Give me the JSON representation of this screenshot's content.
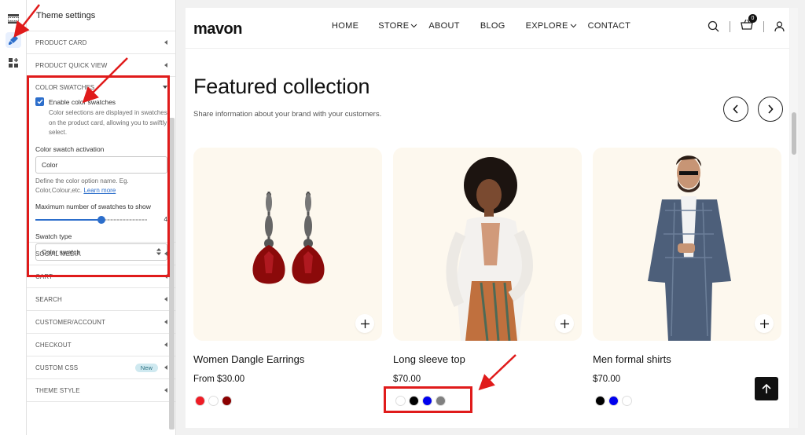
{
  "panel": {
    "title": "Theme settings",
    "sections_top": [
      "PRODUCT CARD",
      "PRODUCT QUICK VIEW"
    ],
    "color_swatches": {
      "title": "COLOR SWATCHES",
      "enable_label": "Enable color swatches",
      "enable_help": "Color selections are displayed in swatches on the product card, allowing you to swiftly select.",
      "activation_label": "Color swatch activation",
      "activation_value": "Color",
      "activation_help": "Define the color option name. Eg. Color,Colour,etc.",
      "learn_more": "Learn more",
      "max_label": "Maximum number of swatches to show",
      "max_value": "4",
      "max_fraction": 0.59,
      "type_label": "Swatch type",
      "type_value": "Color swatch"
    },
    "sections_bottom": [
      "SOCIAL MEDIA",
      "CART",
      "SEARCH",
      "CUSTOMER/ACCOUNT",
      "CHECKOUT"
    ],
    "custom_css": {
      "label": "CUSTOM CSS",
      "badge": "New"
    },
    "theme_style": "THEME STYLE"
  },
  "store": {
    "logo": "mavon",
    "menu": [
      "HOME",
      "STORE",
      "ABOUT",
      "BLOG",
      "EXPLORE",
      "CONTACT"
    ],
    "cart_count": "0",
    "heading": "Featured collection",
    "subheading": "Share information about your brand with your customers.",
    "products": [
      {
        "title": "Women Dangle Earrings",
        "price": "From $30.00",
        "swatches": [
          "#ee1c25",
          "#ffffff",
          "#8b0000"
        ]
      },
      {
        "title": "Long sleeve top",
        "price": "$70.00",
        "swatches": [
          "#ffffff",
          "#000000",
          "#0000ee",
          "#808080"
        ]
      },
      {
        "title": "Men formal shirts",
        "price": "$70.00",
        "swatches": [
          "#000000",
          "#0000ee",
          "#ffffff"
        ]
      }
    ]
  },
  "colors": {
    "accent": "#2c6ecb",
    "highlight": "#e01b1b"
  }
}
